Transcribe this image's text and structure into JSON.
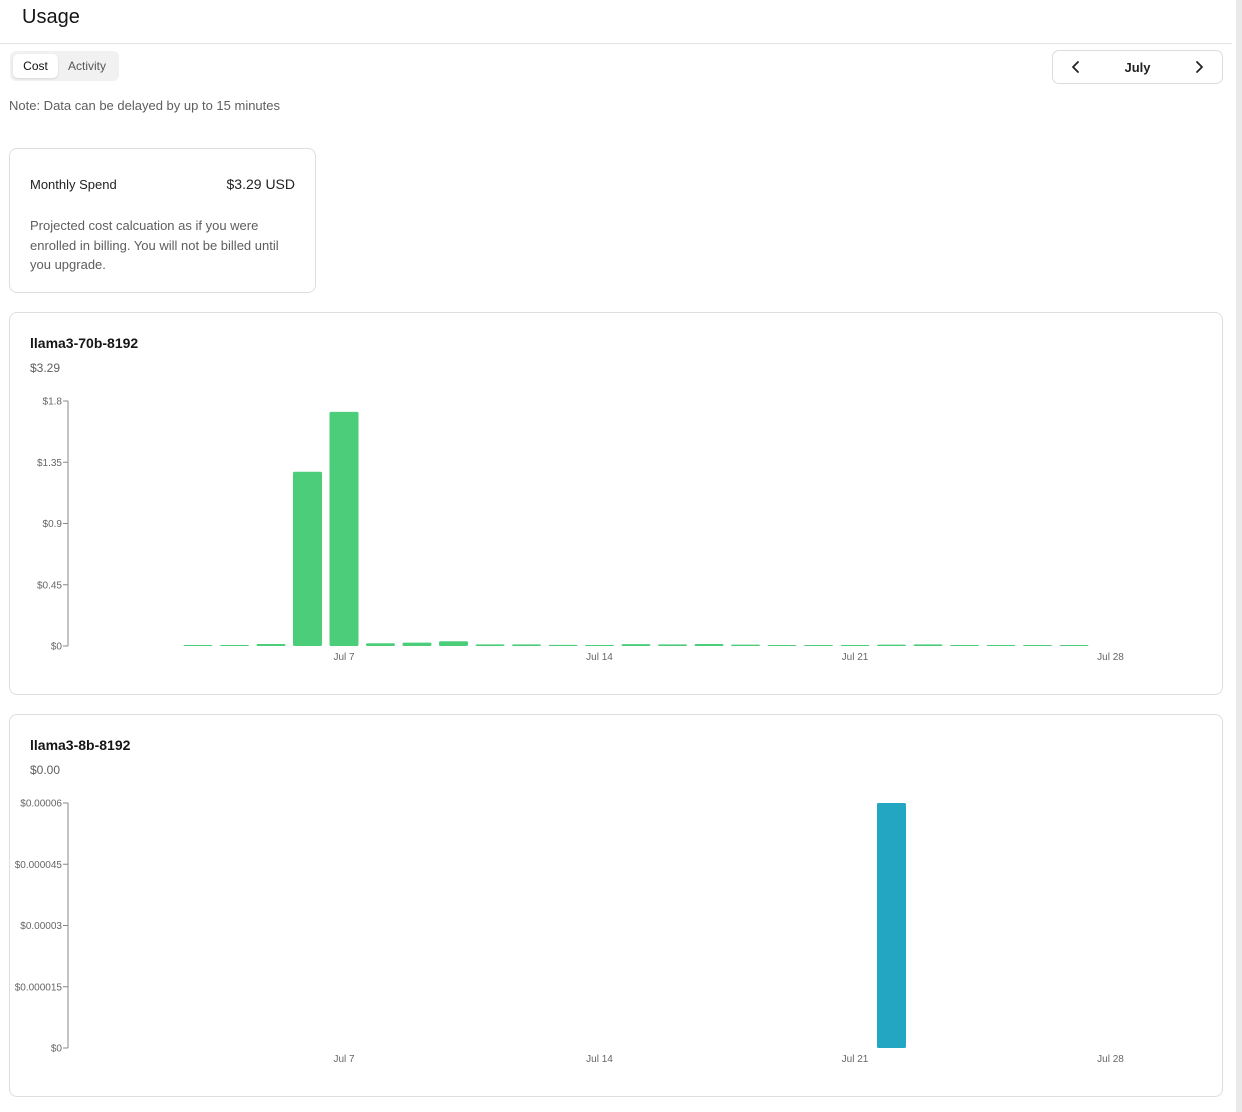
{
  "header": {
    "title": "Usage"
  },
  "tabs": [
    {
      "label": "Cost",
      "active": true
    },
    {
      "label": "Activity",
      "active": false
    }
  ],
  "month_nav": {
    "month": "July",
    "prev_icon": "chevron-left-icon",
    "next_icon": "chevron-right-icon"
  },
  "note": "Note: Data can be delayed by up to 15 minutes",
  "spend": {
    "label": "Monthly Spend",
    "value": "$3.29 USD",
    "description": "Projected cost calcuation as if you were enrolled in billing. You will not be billed until you upgrade."
  },
  "colors": {
    "series1": "#4ccd7a",
    "series2": "#22a6c1"
  },
  "charts": [
    {
      "model": "llama3-70b-8192",
      "total": "$3.29"
    },
    {
      "model": "llama3-8b-8192",
      "total": "$0.00"
    }
  ],
  "chart_data": [
    {
      "type": "bar",
      "title": "llama3-70b-8192",
      "x": [
        "Jul 3",
        "Jul 4",
        "Jul 5",
        "Jul 6",
        "Jul 7",
        "Jul 8",
        "Jul 9",
        "Jul 10",
        "Jul 11",
        "Jul 12",
        "Jul 13",
        "Jul 14",
        "Jul 15",
        "Jul 16",
        "Jul 17",
        "Jul 18",
        "Jul 19",
        "Jul 20",
        "Jul 21",
        "Jul 22",
        "Jul 23",
        "Jul 24",
        "Jul 25",
        "Jul 26",
        "Jul 27"
      ],
      "values": [
        0.005,
        0.004,
        0.015,
        1.28,
        1.72,
        0.02,
        0.025,
        0.035,
        0.012,
        0.012,
        0.008,
        0.004,
        0.014,
        0.012,
        0.015,
        0.01,
        0.006,
        0.006,
        0.006,
        0.01,
        0.012,
        0.006,
        0.006,
        0.002,
        0.0
      ],
      "xticks": [
        "Jul 7",
        "Jul 14",
        "Jul 21",
        "Jul 28"
      ],
      "yticks": [
        "$0",
        "$0.45",
        "$0.9",
        "$1.35",
        "$1.8"
      ],
      "ylim": [
        0,
        1.8
      ],
      "grid": false,
      "color": "#4ccd7a"
    },
    {
      "type": "bar",
      "title": "llama3-8b-8192",
      "x": [
        "Jul 22"
      ],
      "values": [
        6e-05
      ],
      "xticks": [
        "Jul 7",
        "Jul 14",
        "Jul 21",
        "Jul 28"
      ],
      "yticks": [
        "$0",
        "$0.000015",
        "$0.00003",
        "$0.000045",
        "$0.00006"
      ],
      "ylim": [
        0,
        6e-05
      ],
      "grid": false,
      "color": "#22a6c1"
    }
  ]
}
